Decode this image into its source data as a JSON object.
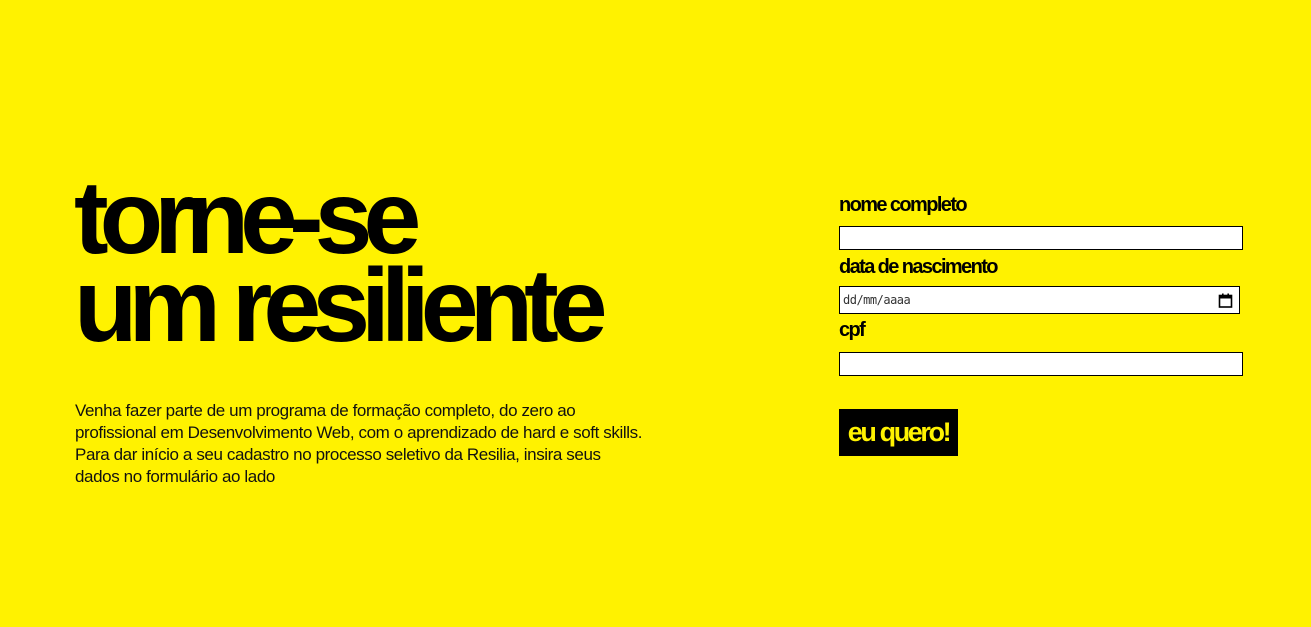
{
  "hero": {
    "title_line1": "torne-se",
    "title_line2": "um resiliente",
    "description": "Venha fazer parte de um programa de formação completo, do zero ao profissional em Desenvolvimento Web, com o aprendizado de hard e soft skills. Para dar início a seu cadastro no processo seletivo da Resilia, insira seus dados no formulário ao lado"
  },
  "form": {
    "name_label": "nome completo",
    "name_value": "",
    "birthdate_label": "data de nascimento",
    "birthdate_placeholder": "dd/mm/aaaa",
    "birthdate_icon": "calendar-icon",
    "cpf_label": "cpf",
    "cpf_value": "",
    "submit_label": "eu quero!"
  },
  "colors": {
    "background": "#fff200",
    "text": "#000000",
    "button_bg": "#000000",
    "button_text": "#fff200"
  }
}
